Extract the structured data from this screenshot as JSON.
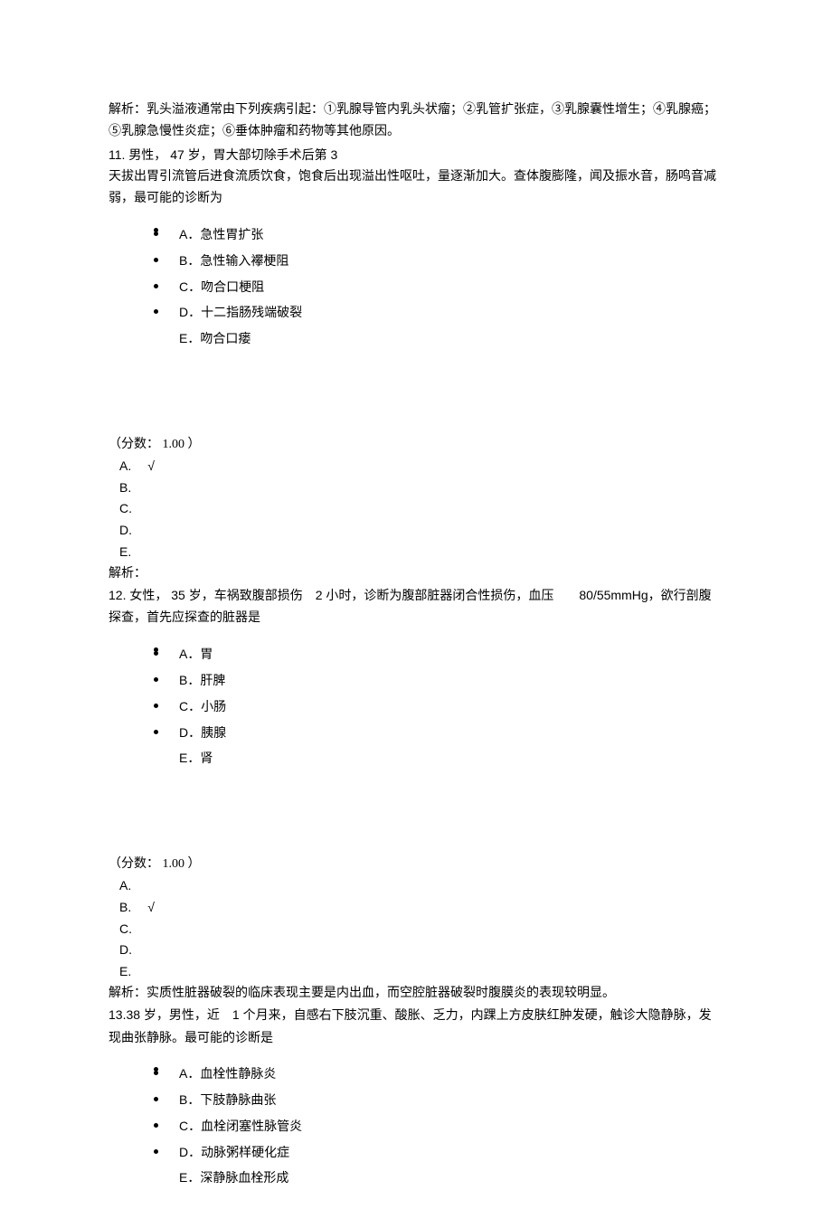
{
  "intro_analysis": "解析：乳头溢液通常由下列疾病引起：①乳腺导管内乳头状瘤；②乳管扩张症，③乳腺囊性增生；④乳腺癌；⑤乳腺急慢性炎症；⑥垂体肿瘤和药物等其他原因。",
  "q11": {
    "stem_line1": "11. 男性， 47 岁，胃大部切除手术后第 3",
    "stem_line2": "天拔出胃引流管后进食流质饮食，饱食后出现溢出性呕吐，量逐渐加大。查体腹膨隆，闻及振水音，肠鸣音减弱，最可能的诊断为",
    "options": {
      "A": "A．急性胃扩张",
      "B": "B．急性输入襻梗阻",
      "C": "C．吻合口梗阻",
      "D": "D．十二指肠残端破裂",
      "E": "E．吻合口瘘"
    },
    "score_label": "（分数： 1.00 ）",
    "answers": {
      "A": "A.",
      "B": "B.",
      "C": "C.",
      "D": "D.",
      "E": "E."
    },
    "tick": "√",
    "analysis": "解析："
  },
  "q12": {
    "stem": "12. 女性， 35 岁，车祸致腹部损伤　2 小时，诊断为腹部脏器闭合性损伤，血压　　80/55mmHg，欲行剖腹探查，首先应探查的脏器是",
    "options": {
      "A": "A．胃",
      "B": "B．肝脾",
      "C": "C．小肠",
      "D": "D．胰腺",
      "E": "E．肾"
    },
    "score_label": "（分数： 1.00 ）",
    "answers": {
      "A": "A.",
      "B": "B.",
      "C": "C.",
      "D": "D.",
      "E": "E."
    },
    "tick": "√",
    "analysis": "解析：实质性脏器破裂的临床表现主要是内出血，而空腔脏器破裂时腹膜炎的表现较明显。"
  },
  "q13": {
    "stem": "13.38 岁，男性，近　1 个月来，自感右下肢沉重、酸胀、乏力，内踝上方皮肤红肿发硬，触诊大隐静脉，发现曲张静脉。最可能的诊断是",
    "options": {
      "A": "A．血栓性静脉炎",
      "B": "B．下肢静脉曲张",
      "C": "C．血栓闭塞性脉管炎",
      "D": "D．动脉粥样硬化症",
      "E": "E．深静脉血栓形成"
    }
  }
}
